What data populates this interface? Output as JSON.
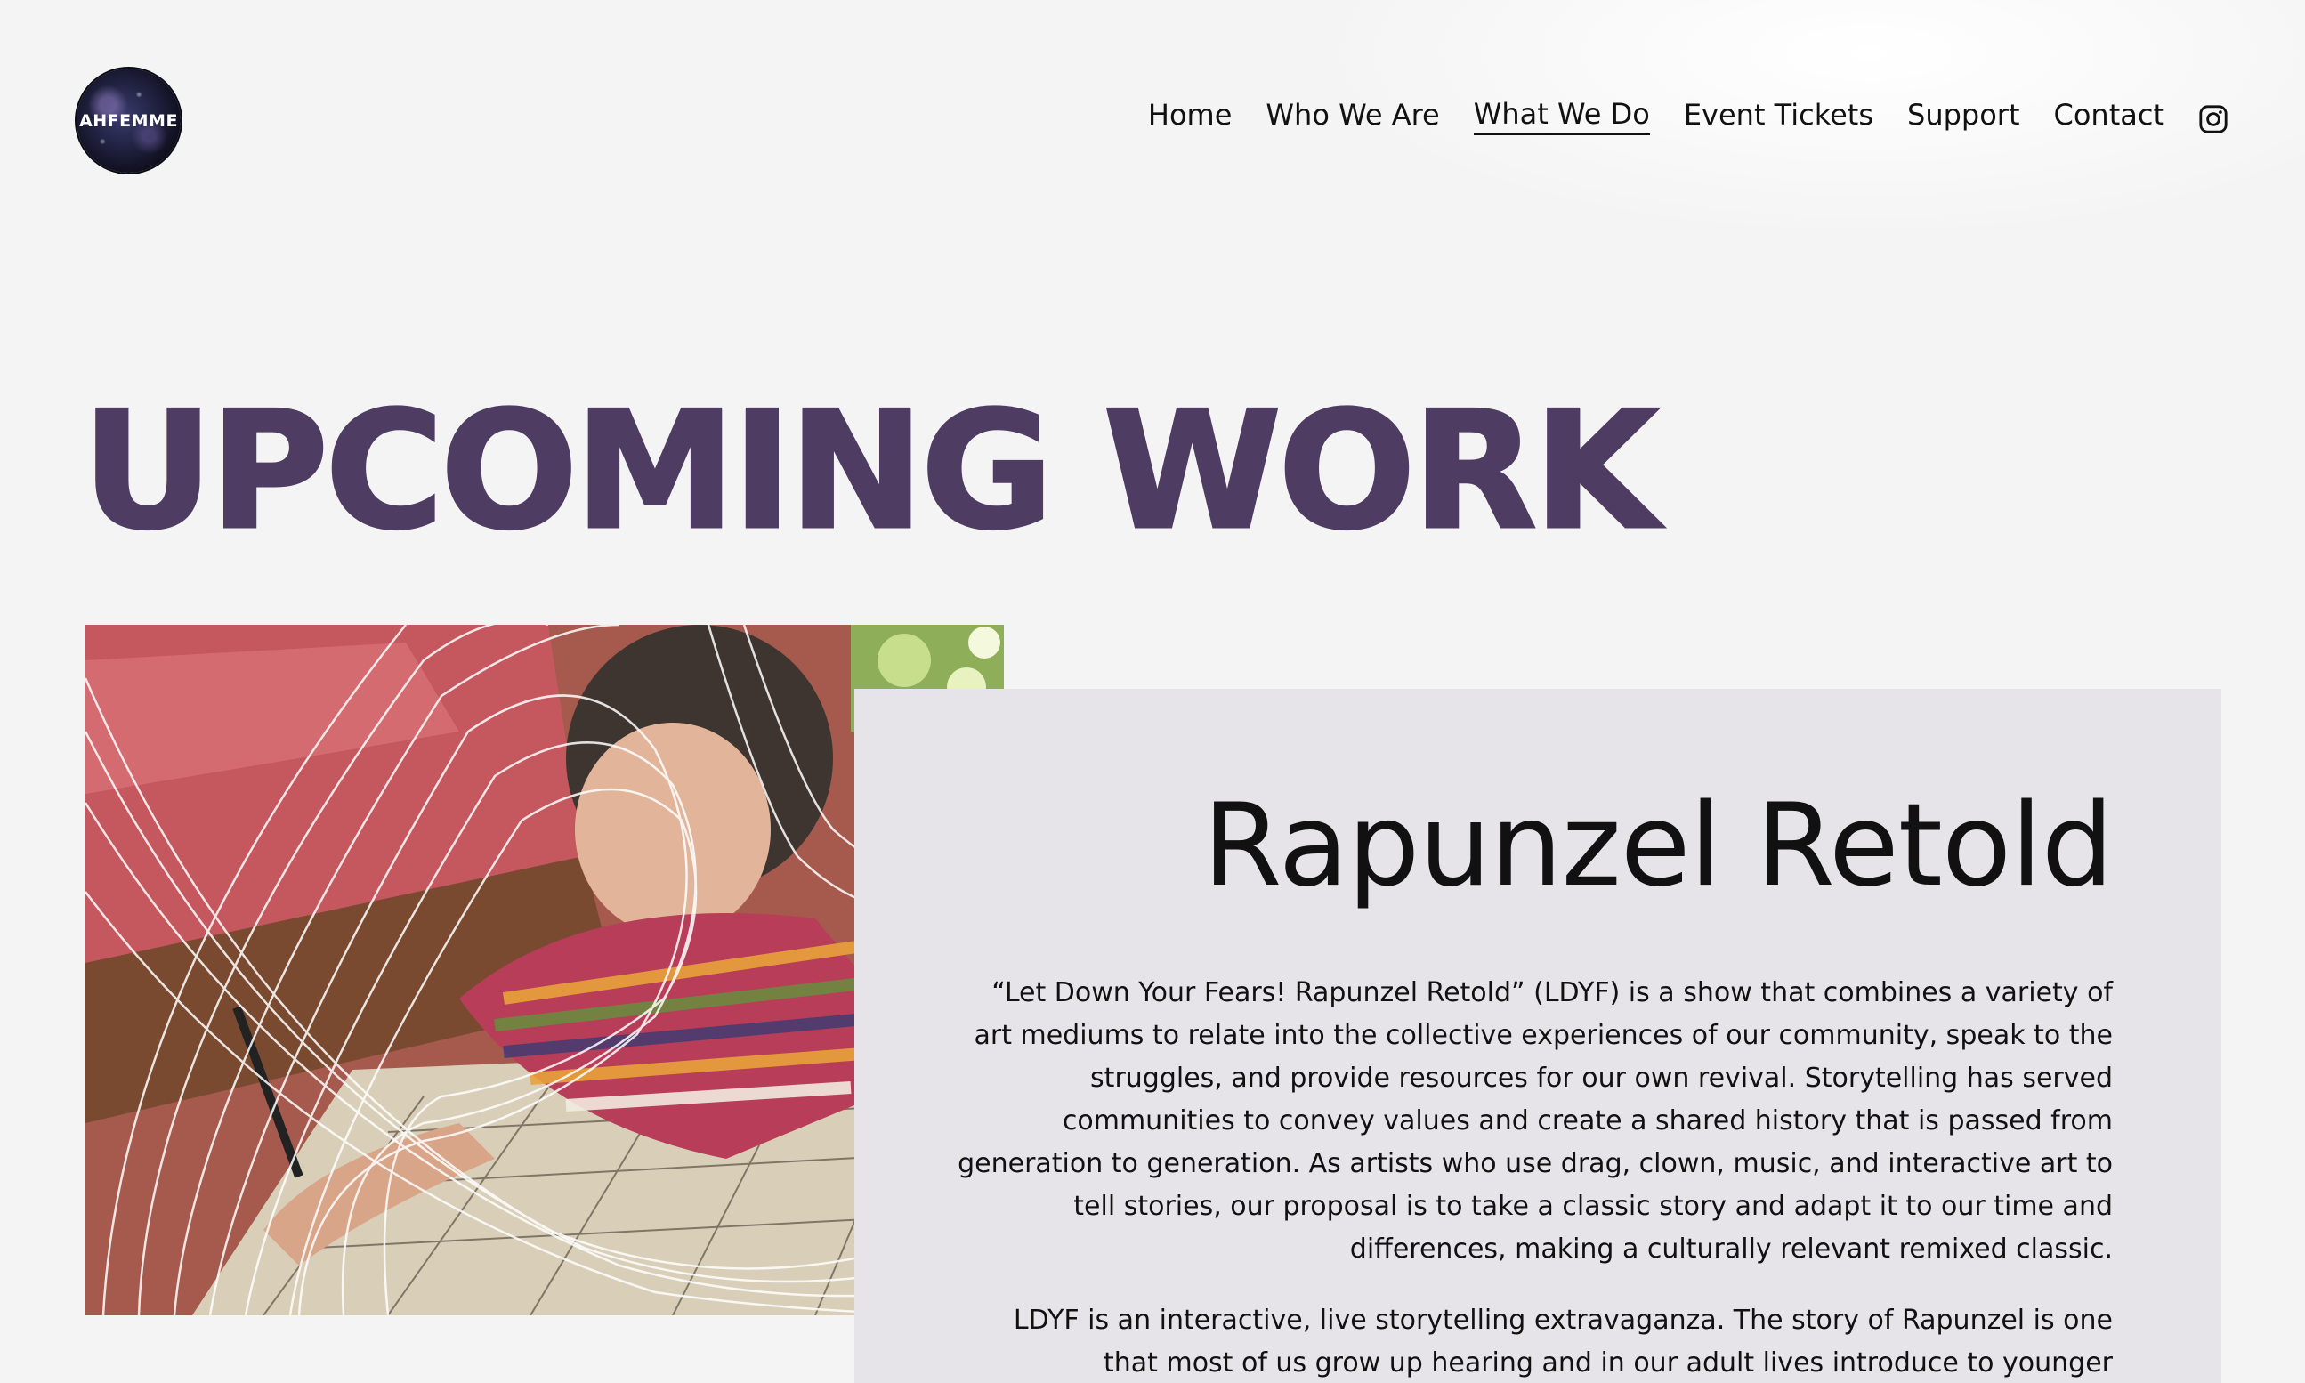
{
  "header": {
    "logo_text": "AHFEMME",
    "nav": [
      {
        "label": "Home",
        "active": false
      },
      {
        "label": "Who We Are",
        "active": false
      },
      {
        "label": "What We Do",
        "active": true
      },
      {
        "label": "Event Tickets",
        "active": false
      },
      {
        "label": "Support",
        "active": false
      },
      {
        "label": "Contact",
        "active": false
      }
    ],
    "social_icon": "instagram-icon"
  },
  "main": {
    "title": "UPCOMING WORK",
    "feature": {
      "title": "Rapunzel Retold",
      "paragraphs": [
        "“Let Down Your Fears! Rapunzel Retold” (LDYF) is a show that combines a variety of art mediums to relate into the collective experiences of our community, speak to the struggles, and provide resources for our own revival. Storytelling has served communities to convey values and create a shared history that is passed from generation to generation. As artists who use drag, clown, music, and interactive art to tell stories, our proposal is to take a classic story and adapt it to our time and differences, making a culturally relevant remixed classic.",
        "LDYF is an interactive, live storytelling extravaganza. The story of Rapunzel is one that most of us grow up hearing and in our adult lives introduce to younger"
      ]
    }
  },
  "colors": {
    "title": "#4e3c62",
    "card_bg": "#e6e4e8",
    "page_bg": "#f4f4f4"
  }
}
